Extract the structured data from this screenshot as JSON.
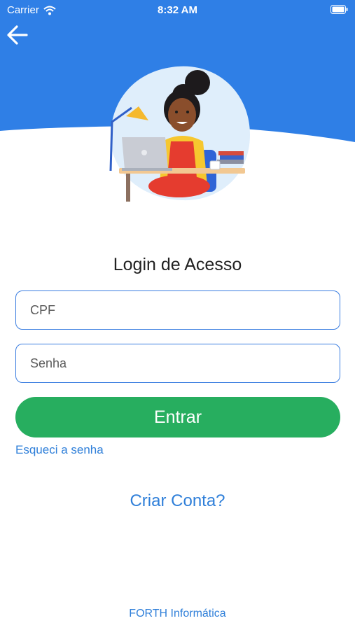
{
  "status_bar": {
    "carrier": "Carrier",
    "time": "8:32 AM",
    "icons": [
      "wifi-icon",
      "battery-icon"
    ]
  },
  "colors": {
    "header_blue": "#2f7fe6",
    "button_green": "#27ae5f",
    "link_blue": "#2f7fd9"
  },
  "header": {
    "back_icon": "arrow-left-icon",
    "illustration": "girl-at-laptop-illustration"
  },
  "login": {
    "title": "Login de Acesso",
    "cpf_placeholder": "CPF",
    "cpf_value": "",
    "password_placeholder": "Senha",
    "password_value": "",
    "submit_label": "Entrar",
    "forgot_label": "Esqueci a senha",
    "create_label": "Criar Conta?"
  },
  "footer": {
    "text": "FORTH Informática"
  }
}
